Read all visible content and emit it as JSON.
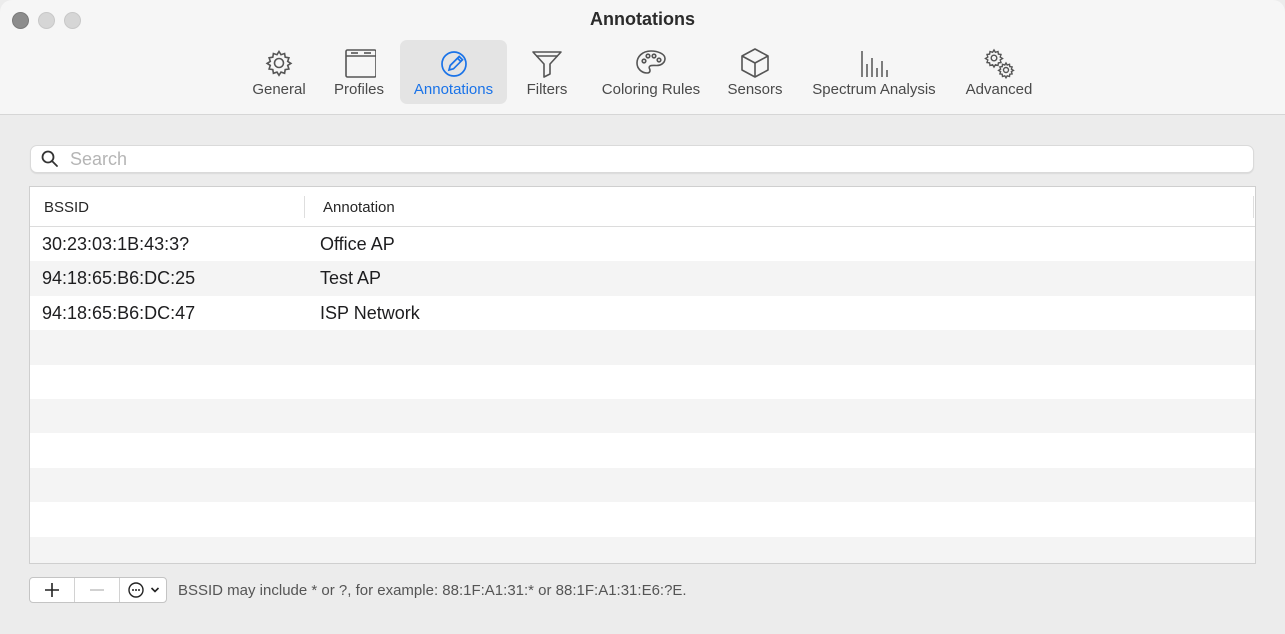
{
  "window": {
    "title": "Annotations"
  },
  "toolbar": {
    "tabs": [
      {
        "label": "General",
        "icon": "gear-icon"
      },
      {
        "label": "Profiles",
        "icon": "window-icon"
      },
      {
        "label": "Annotations",
        "icon": "pencil-circle-icon",
        "active": true
      },
      {
        "label": "Filters",
        "icon": "funnel-icon"
      },
      {
        "label": "Coloring Rules",
        "icon": "palette-icon"
      },
      {
        "label": "Sensors",
        "icon": "cube-icon"
      },
      {
        "label": "Spectrum Analysis",
        "icon": "spectrum-bars-icon"
      },
      {
        "label": "Advanced",
        "icon": "gears-icon"
      }
    ]
  },
  "search": {
    "placeholder": "Search",
    "value": ""
  },
  "table": {
    "columns": [
      "BSSID",
      "Annotation"
    ],
    "rows": [
      {
        "bssid": "30:23:03:1B:43:3?",
        "annotation": "Office AP"
      },
      {
        "bssid": "94:18:65:B6:DC:25",
        "annotation": "Test AP"
      },
      {
        "bssid": "94:18:65:B6:DC:47",
        "annotation": "ISP Network"
      }
    ]
  },
  "footer": {
    "hint": "BSSID may include * or ?, for example: 88:1F:A1:31:* or 88:1F:A1:31:E6:?E."
  },
  "colors": {
    "accent": "#1a73e8",
    "active_tab_bg": "#e4e4e4"
  }
}
